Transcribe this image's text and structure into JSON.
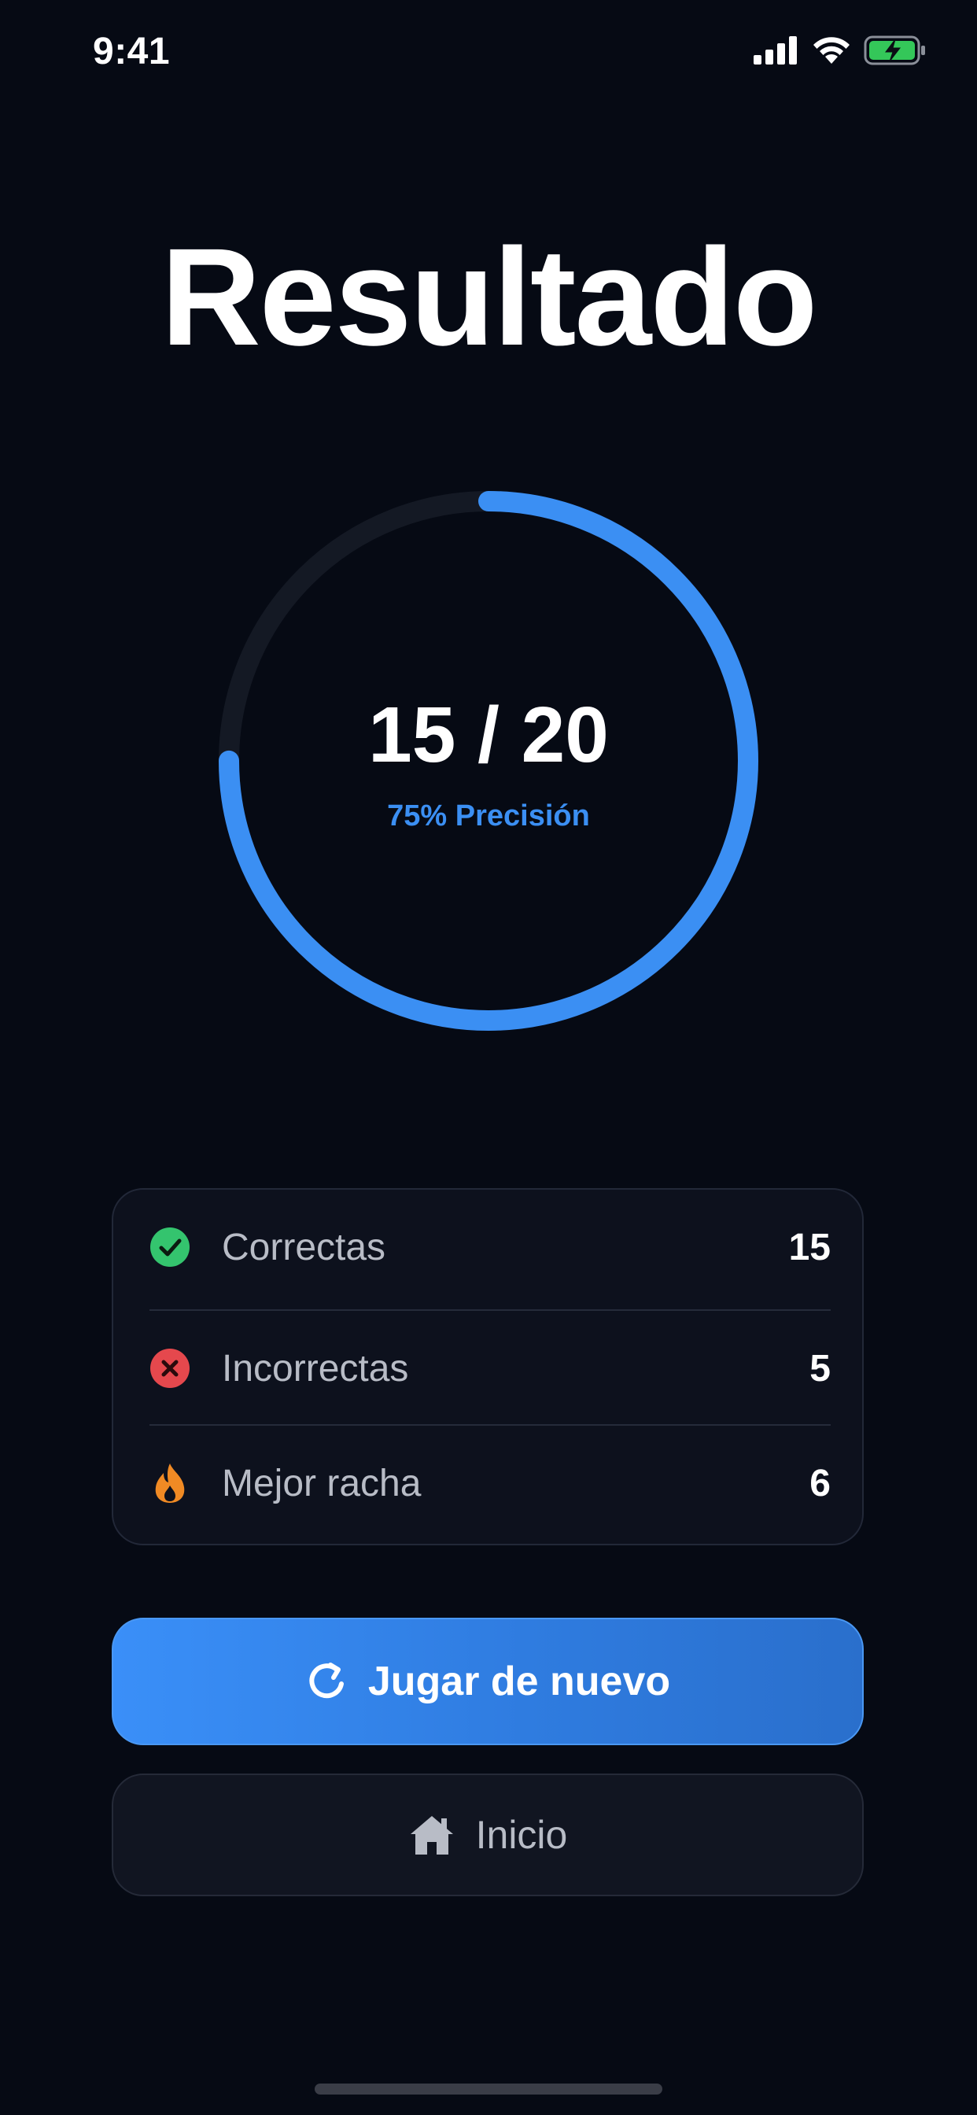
{
  "status_bar": {
    "time": "9:41"
  },
  "title": "Resultado",
  "result": {
    "score_text": "15 / 20",
    "accuracy_text": "75% Precisión",
    "accuracy_fraction": 0.75
  },
  "stats": [
    {
      "label": "Correctas",
      "value": "15",
      "icon": "check-circle-icon",
      "color": "#34c46e"
    },
    {
      "label": "Incorrectas",
      "value": "5",
      "icon": "x-circle-icon",
      "color": "#e5484d"
    },
    {
      "label": "Mejor racha",
      "value": "6",
      "icon": "flame-icon",
      "color": "#f08a24"
    }
  ],
  "buttons": {
    "play_again_label": "Jugar de nuevo",
    "home_label": "Inicio"
  },
  "colors": {
    "background": "#060a14",
    "accent": "#3b8ff3",
    "ring_track": "#141924"
  }
}
